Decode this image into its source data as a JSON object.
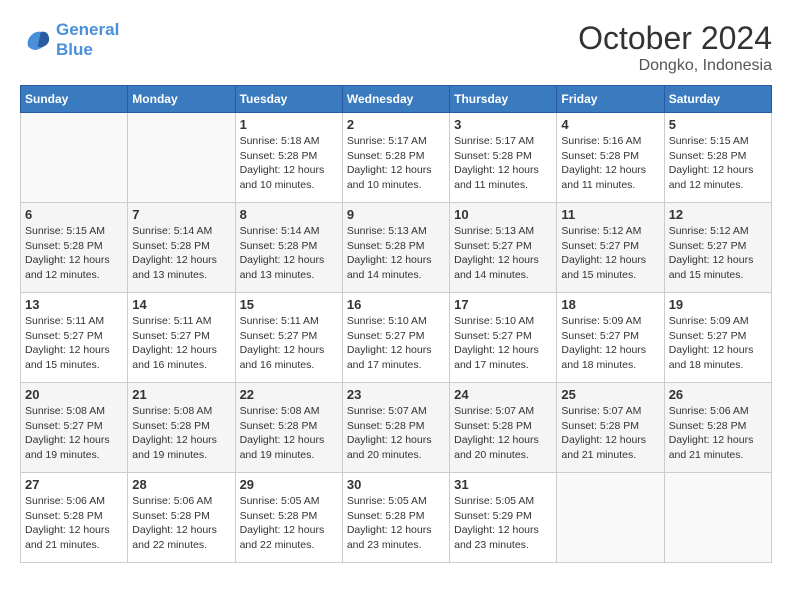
{
  "header": {
    "logo_line1": "General",
    "logo_line2": "Blue",
    "month_year": "October 2024",
    "location": "Dongko, Indonesia"
  },
  "weekdays": [
    "Sunday",
    "Monday",
    "Tuesday",
    "Wednesday",
    "Thursday",
    "Friday",
    "Saturday"
  ],
  "weeks": [
    [
      {
        "day": "",
        "detail": ""
      },
      {
        "day": "",
        "detail": ""
      },
      {
        "day": "1",
        "detail": "Sunrise: 5:18 AM\nSunset: 5:28 PM\nDaylight: 12 hours\nand 10 minutes."
      },
      {
        "day": "2",
        "detail": "Sunrise: 5:17 AM\nSunset: 5:28 PM\nDaylight: 12 hours\nand 10 minutes."
      },
      {
        "day": "3",
        "detail": "Sunrise: 5:17 AM\nSunset: 5:28 PM\nDaylight: 12 hours\nand 11 minutes."
      },
      {
        "day": "4",
        "detail": "Sunrise: 5:16 AM\nSunset: 5:28 PM\nDaylight: 12 hours\nand 11 minutes."
      },
      {
        "day": "5",
        "detail": "Sunrise: 5:15 AM\nSunset: 5:28 PM\nDaylight: 12 hours\nand 12 minutes."
      }
    ],
    [
      {
        "day": "6",
        "detail": "Sunrise: 5:15 AM\nSunset: 5:28 PM\nDaylight: 12 hours\nand 12 minutes."
      },
      {
        "day": "7",
        "detail": "Sunrise: 5:14 AM\nSunset: 5:28 PM\nDaylight: 12 hours\nand 13 minutes."
      },
      {
        "day": "8",
        "detail": "Sunrise: 5:14 AM\nSunset: 5:28 PM\nDaylight: 12 hours\nand 13 minutes."
      },
      {
        "day": "9",
        "detail": "Sunrise: 5:13 AM\nSunset: 5:28 PM\nDaylight: 12 hours\nand 14 minutes."
      },
      {
        "day": "10",
        "detail": "Sunrise: 5:13 AM\nSunset: 5:27 PM\nDaylight: 12 hours\nand 14 minutes."
      },
      {
        "day": "11",
        "detail": "Sunrise: 5:12 AM\nSunset: 5:27 PM\nDaylight: 12 hours\nand 15 minutes."
      },
      {
        "day": "12",
        "detail": "Sunrise: 5:12 AM\nSunset: 5:27 PM\nDaylight: 12 hours\nand 15 minutes."
      }
    ],
    [
      {
        "day": "13",
        "detail": "Sunrise: 5:11 AM\nSunset: 5:27 PM\nDaylight: 12 hours\nand 15 minutes."
      },
      {
        "day": "14",
        "detail": "Sunrise: 5:11 AM\nSunset: 5:27 PM\nDaylight: 12 hours\nand 16 minutes."
      },
      {
        "day": "15",
        "detail": "Sunrise: 5:11 AM\nSunset: 5:27 PM\nDaylight: 12 hours\nand 16 minutes."
      },
      {
        "day": "16",
        "detail": "Sunrise: 5:10 AM\nSunset: 5:27 PM\nDaylight: 12 hours\nand 17 minutes."
      },
      {
        "day": "17",
        "detail": "Sunrise: 5:10 AM\nSunset: 5:27 PM\nDaylight: 12 hours\nand 17 minutes."
      },
      {
        "day": "18",
        "detail": "Sunrise: 5:09 AM\nSunset: 5:27 PM\nDaylight: 12 hours\nand 18 minutes."
      },
      {
        "day": "19",
        "detail": "Sunrise: 5:09 AM\nSunset: 5:27 PM\nDaylight: 12 hours\nand 18 minutes."
      }
    ],
    [
      {
        "day": "20",
        "detail": "Sunrise: 5:08 AM\nSunset: 5:27 PM\nDaylight: 12 hours\nand 19 minutes."
      },
      {
        "day": "21",
        "detail": "Sunrise: 5:08 AM\nSunset: 5:28 PM\nDaylight: 12 hours\nand 19 minutes."
      },
      {
        "day": "22",
        "detail": "Sunrise: 5:08 AM\nSunset: 5:28 PM\nDaylight: 12 hours\nand 19 minutes."
      },
      {
        "day": "23",
        "detail": "Sunrise: 5:07 AM\nSunset: 5:28 PM\nDaylight: 12 hours\nand 20 minutes."
      },
      {
        "day": "24",
        "detail": "Sunrise: 5:07 AM\nSunset: 5:28 PM\nDaylight: 12 hours\nand 20 minutes."
      },
      {
        "day": "25",
        "detail": "Sunrise: 5:07 AM\nSunset: 5:28 PM\nDaylight: 12 hours\nand 21 minutes."
      },
      {
        "day": "26",
        "detail": "Sunrise: 5:06 AM\nSunset: 5:28 PM\nDaylight: 12 hours\nand 21 minutes."
      }
    ],
    [
      {
        "day": "27",
        "detail": "Sunrise: 5:06 AM\nSunset: 5:28 PM\nDaylight: 12 hours\nand 21 minutes."
      },
      {
        "day": "28",
        "detail": "Sunrise: 5:06 AM\nSunset: 5:28 PM\nDaylight: 12 hours\nand 22 minutes."
      },
      {
        "day": "29",
        "detail": "Sunrise: 5:05 AM\nSunset: 5:28 PM\nDaylight: 12 hours\nand 22 minutes."
      },
      {
        "day": "30",
        "detail": "Sunrise: 5:05 AM\nSunset: 5:28 PM\nDaylight: 12 hours\nand 23 minutes."
      },
      {
        "day": "31",
        "detail": "Sunrise: 5:05 AM\nSunset: 5:29 PM\nDaylight: 12 hours\nand 23 minutes."
      },
      {
        "day": "",
        "detail": ""
      },
      {
        "day": "",
        "detail": ""
      }
    ]
  ]
}
